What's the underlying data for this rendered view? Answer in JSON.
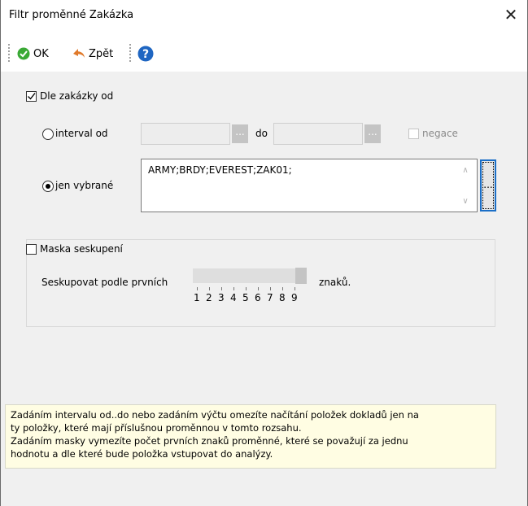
{
  "window": {
    "title": "Filtr proměnné Zakázka"
  },
  "toolbar": {
    "ok_label": "OK",
    "back_label": "Zpět"
  },
  "filter": {
    "checkbox_label": "Dle zakázky od",
    "checkbox_checked": true,
    "interval_label": "interval od",
    "do_label": "do",
    "negace_label": "negace",
    "ellipsis": "...",
    "selected_label": "jen vybrané",
    "selected_value": "ARMY;BRDY;EVEREST;ZAK01;"
  },
  "mask": {
    "checkbox_label": "Maska seskupení",
    "checkbox_checked": false,
    "group_label": "Seskupovat podle prvních",
    "suffix_label": "znaků.",
    "slider_value": 9,
    "ticks": [
      "1",
      "2",
      "3",
      "4",
      "5",
      "6",
      "7",
      "8",
      "9"
    ]
  },
  "info": {
    "line1": "Zadáním intervalu od..do nebo zadáním výčtu omezíte načítání položek dokladů jen na",
    "line2": "ty položky, které mají příslušnou proměnnou v tomto rozsahu.",
    "line3": "Zadáním masky vymezíte počet prvních znaků proměnné, které se považují za jednu",
    "line4": "hodnotu a dle které bude položka vstupovat do analýzy."
  },
  "colors": {
    "ok_icon": "#3aa935",
    "back_icon": "#e07a2b",
    "help_icon": "#1f66c2",
    "info_bg": "#fffde3"
  }
}
